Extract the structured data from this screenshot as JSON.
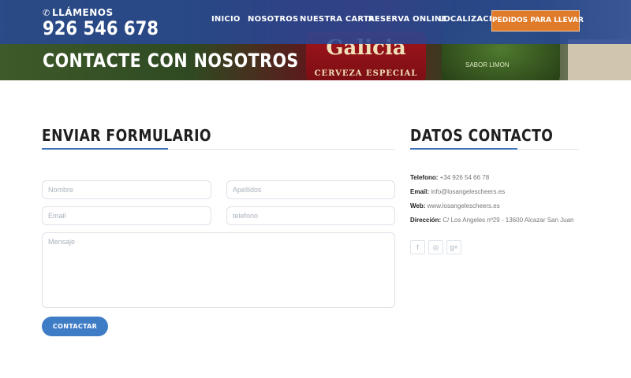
{
  "header": {
    "call_label": "LLÁMENOS",
    "phone": "926 546 678",
    "nav": [
      "INICIO",
      "NOSOTROS",
      "NUESTRA CARTA",
      "RESERVA ONLINE",
      "LOCALIZACION"
    ],
    "cta": "PEDIDOS PARA LLEVAR"
  },
  "hero": {
    "title": "CONTACTE CON NOSOTROS",
    "label_text": "Galicia",
    "label_sub": "CERVEZA ESPECIAL",
    "bottle2_text": "SABOR LIMON"
  },
  "form": {
    "title": "ENVIAR FORMULARIO",
    "name_placeholder": "Nombre",
    "surname_placeholder": "Apellidos",
    "email_placeholder": "Email",
    "phone_placeholder": "telefono",
    "message_placeholder": "Mensaje",
    "submit": "CONTACTAR"
  },
  "contact": {
    "title": "DATOS CONTACTO",
    "phone_label": "Telefono:",
    "phone_value": "+34 926 54 66 78",
    "email_label": "Email:",
    "email_value": "info@losangelescheers.es",
    "web_label": "Web:",
    "web_value": "www.losangelescheers.es",
    "address_label": "Dirección:",
    "address_value": "C/ Los Angeles nº29 - 13600 Alcazar San Juan"
  },
  "social": {
    "icons": [
      "facebook-icon",
      "instagram-icon",
      "google-plus-icon"
    ],
    "glyphs": [
      "f",
      "◎",
      "g+"
    ]
  },
  "colors": {
    "header_bar": "#2a4896",
    "accent_blue": "#3f73b9",
    "cta_orange": "#e07b2a"
  }
}
